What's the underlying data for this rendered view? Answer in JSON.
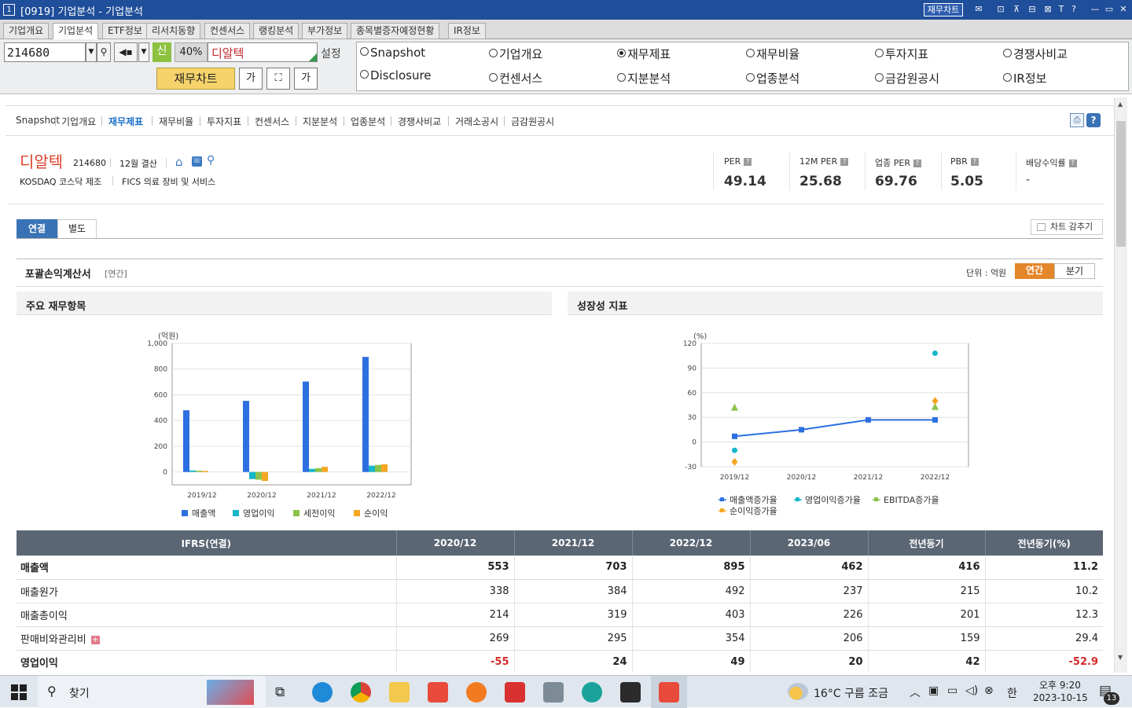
{
  "window": {
    "number": "1",
    "title": "[0919] 기업분석 - 기업분석",
    "chart_button": "재무차트",
    "controls": [
      "⊡",
      "⊼",
      "⊟",
      "⊠",
      "T",
      "?",
      "—",
      "▭",
      "✕"
    ]
  },
  "menubar": {
    "tabs": [
      "기업개요",
      "기업분석",
      "ETF정보",
      "리서치동향",
      "컨센서스",
      "랭킹분석",
      "부가정보",
      "종목별증자예정현황",
      "IR정보"
    ],
    "active": "기업분석"
  },
  "controls": {
    "code": "214680",
    "new_badge": "신",
    "percent": "40%",
    "company": "디알텍",
    "setting": "설정",
    "chart_btn": "재무차트",
    "font_btn": "가"
  },
  "radios": [
    {
      "label": "Snapshot",
      "checked": false
    },
    {
      "label": "기업개요",
      "checked": false
    },
    {
      "label": "재무제표",
      "checked": true
    },
    {
      "label": "재무비율",
      "checked": false
    },
    {
      "label": "투자지표",
      "checked": false
    },
    {
      "label": "경쟁사비교",
      "checked": false
    },
    {
      "label": "Disclosure",
      "checked": false
    },
    {
      "label": "컨센서스",
      "checked": false
    },
    {
      "label": "지분분석",
      "checked": false
    },
    {
      "label": "업종분석",
      "checked": false
    },
    {
      "label": "금감원공시",
      "checked": false
    },
    {
      "label": "IR정보",
      "checked": false
    }
  ],
  "subnav": {
    "items": [
      "Snapshot",
      "기업개요",
      "재무제표",
      "재무비율",
      "투자지표",
      "컨센서스",
      "지분분석",
      "업종분석",
      "경쟁사비교",
      "거래소공시",
      "금감원공시"
    ],
    "active": "재무제표"
  },
  "company": {
    "name": "디알텍",
    "code": "214680",
    "fiscal": "12월 결산",
    "market": "KOSDAQ  코스닥 제조",
    "fics": "FICS 의료 장비 및 서비스"
  },
  "metrics": [
    {
      "label": "PER",
      "value": "49.14"
    },
    {
      "label": "12M PER",
      "value": "25.68"
    },
    {
      "label": "업종 PER",
      "value": "69.76"
    },
    {
      "label": "PBR",
      "value": "5.05"
    },
    {
      "label": "배당수익률",
      "value": "-"
    }
  ],
  "tabs": {
    "consolidated": "연결",
    "separate": "별도",
    "hide_chart": "차트 감추기"
  },
  "statement": {
    "title": "포괄손익계산서",
    "period_tag": "[연간]",
    "unit": "단위 : 억원",
    "annual": "연간",
    "quarter": "분기"
  },
  "panels": {
    "left_title": "주요 재무항목",
    "right_title": "성장성 지표"
  },
  "chart_data": [
    {
      "type": "bar",
      "unit_label": "(억원)",
      "categories": [
        "2019/12",
        "2020/12",
        "2021/12",
        "2022/12"
      ],
      "ylim": [
        -100,
        1000
      ],
      "yticks": [
        "1,000",
        "800",
        "600",
        "400",
        "200",
        "0"
      ],
      "series": [
        {
          "name": "매출액",
          "color": "#2c6fe0",
          "values": [
            480,
            553,
            703,
            895
          ]
        },
        {
          "name": "영업이익",
          "color": "#17b6c9",
          "values": [
            12,
            -55,
            24,
            49
          ]
        },
        {
          "name": "세전이익",
          "color": "#8bc34a",
          "values": [
            10,
            -60,
            30,
            55
          ]
        },
        {
          "name": "순이익",
          "color": "#f5a623",
          "values": [
            8,
            -70,
            40,
            60
          ]
        }
      ]
    },
    {
      "type": "line",
      "unit_label": "(%)",
      "categories": [
        "2019/12",
        "2020/12",
        "2021/12",
        "2022/12"
      ],
      "ylim": [
        -30,
        120
      ],
      "yticks": [
        "120",
        "90",
        "60",
        "30",
        "0",
        "-30"
      ],
      "series": [
        {
          "name": "매출액증가율",
          "color": "#2c6fe0",
          "values": [
            7,
            15,
            27,
            27
          ],
          "marker": "square",
          "line": true
        },
        {
          "name": "영업이익증가율",
          "color": "#17b6c9",
          "values": [
            -10,
            null,
            null,
            108
          ],
          "marker": "circle",
          "line": false
        },
        {
          "name": "EBITDA증가율",
          "color": "#8bc34a",
          "values": [
            42,
            null,
            null,
            43
          ],
          "marker": "triangle",
          "line": false
        },
        {
          "name": "순이익증가율",
          "color": "#f5a623",
          "values": [
            -24,
            null,
            null,
            50
          ],
          "marker": "diamond",
          "line": false
        }
      ]
    }
  ],
  "table": {
    "headers": [
      "IFRS(연결)",
      "2020/12",
      "2021/12",
      "2022/12",
      "2023/06",
      "전년동기",
      "전년동기(%)"
    ],
    "rows": [
      {
        "label": "매출액",
        "bold": true,
        "values": [
          "553",
          "703",
          "895",
          "462",
          "416",
          "11.2"
        ]
      },
      {
        "label": "매출원가",
        "bold": false,
        "values": [
          "338",
          "384",
          "492",
          "237",
          "215",
          "10.2"
        ]
      },
      {
        "label": "매출총이익",
        "bold": false,
        "values": [
          "214",
          "319",
          "403",
          "226",
          "201",
          "12.3"
        ]
      },
      {
        "label": "판매비와관리비",
        "bold": false,
        "expand": "+",
        "values": [
          "269",
          "295",
          "354",
          "206",
          "159",
          "29.4"
        ]
      },
      {
        "label": "영업이익",
        "bold": true,
        "values": [
          "-55",
          "24",
          "49",
          "20",
          "42",
          "-52.9"
        ]
      }
    ]
  },
  "taskbar": {
    "search": "찾기",
    "weather": "16°C  구름 조금",
    "ime": "한",
    "time": "오후 9:20",
    "date": "2023-10-15",
    "notif": "13"
  }
}
